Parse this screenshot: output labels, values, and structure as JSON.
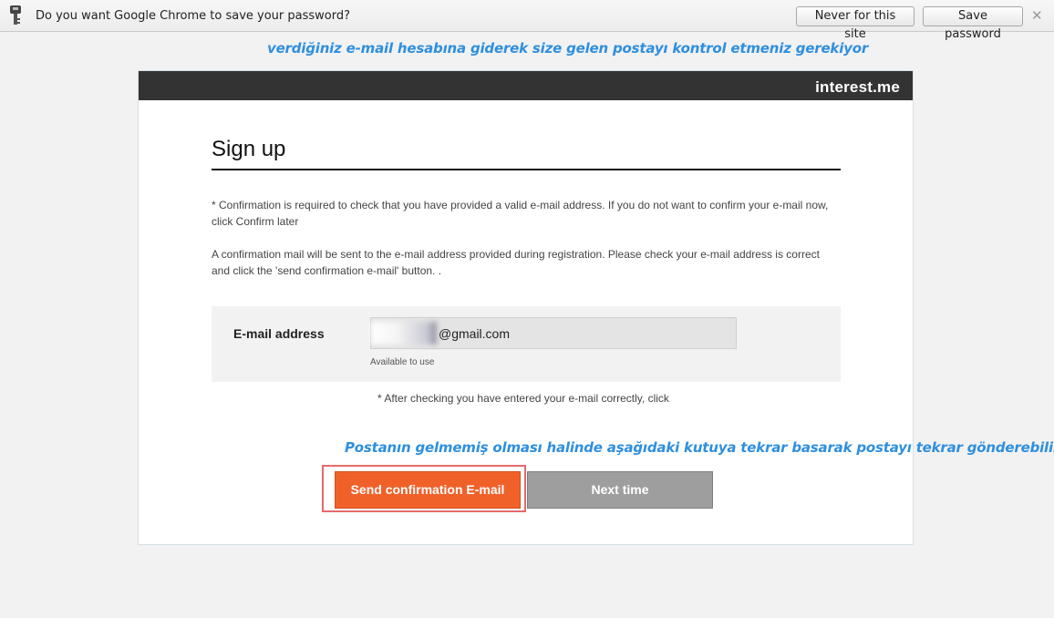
{
  "password_bar": {
    "prompt": "Do you want Google Chrome to save your password?",
    "never_label": "Never for this site",
    "save_label": "Save password",
    "close_glyph": "✕",
    "icon": "key-icon"
  },
  "annotations": {
    "top": "verdiğiniz e-mail hesabına giderek size gelen postayı kontrol etmeniz gerekiyor",
    "middle": "Postanın gelmemiş olması halinde aşağıdaki kutuya tekrar basarak postayı tekrar gönderebilirsiniz.",
    "color": "#2f8fde"
  },
  "site": {
    "brand": "interest.me"
  },
  "signup": {
    "title": "Sign up",
    "note1": "* Confirmation is required to check that you have provided a valid e-mail address. If you do not want to confirm your e-mail now, click Confirm later",
    "note2": "A confirmation mail will be sent to the e-mail address provided during registration. Please check your e-mail address is correct and click the 'send confirmation e-mail' button. .",
    "email_label": "E-mail address",
    "email_value": "@gmail.com",
    "email_status": "Available to use",
    "check_note": "* After checking you have entered your e-mail correctly, click",
    "send_button": "Send confirmation E-mail",
    "next_button": "Next time"
  },
  "colors": {
    "accent": "#f0612a",
    "header_bar": "#333333",
    "secondary_button": "#9e9e9e",
    "highlight": "#e46b6b"
  }
}
